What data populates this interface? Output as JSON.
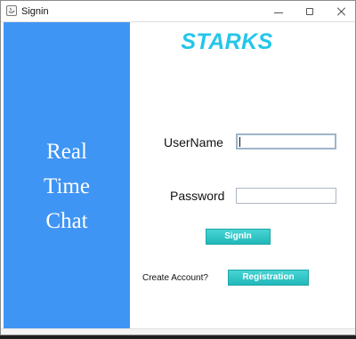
{
  "window": {
    "title": "Signin",
    "controls": {
      "minimize": "minimize-icon",
      "maximize": "maximize-icon",
      "close": "close-icon"
    }
  },
  "sidebar": {
    "lines": [
      "Real",
      "Time",
      "Chat"
    ],
    "background_color": "#3f95f4",
    "text_color": "#ffffff"
  },
  "brand": {
    "title": "STARKS",
    "color": "#24c6ea"
  },
  "form": {
    "username_label": "UserName",
    "username_value": "",
    "password_label": "Password",
    "password_value": "",
    "signin_button": "SignIn",
    "create_account_text": "Create Account?",
    "registration_button": "Registration",
    "button_color": "#22b8ba"
  }
}
